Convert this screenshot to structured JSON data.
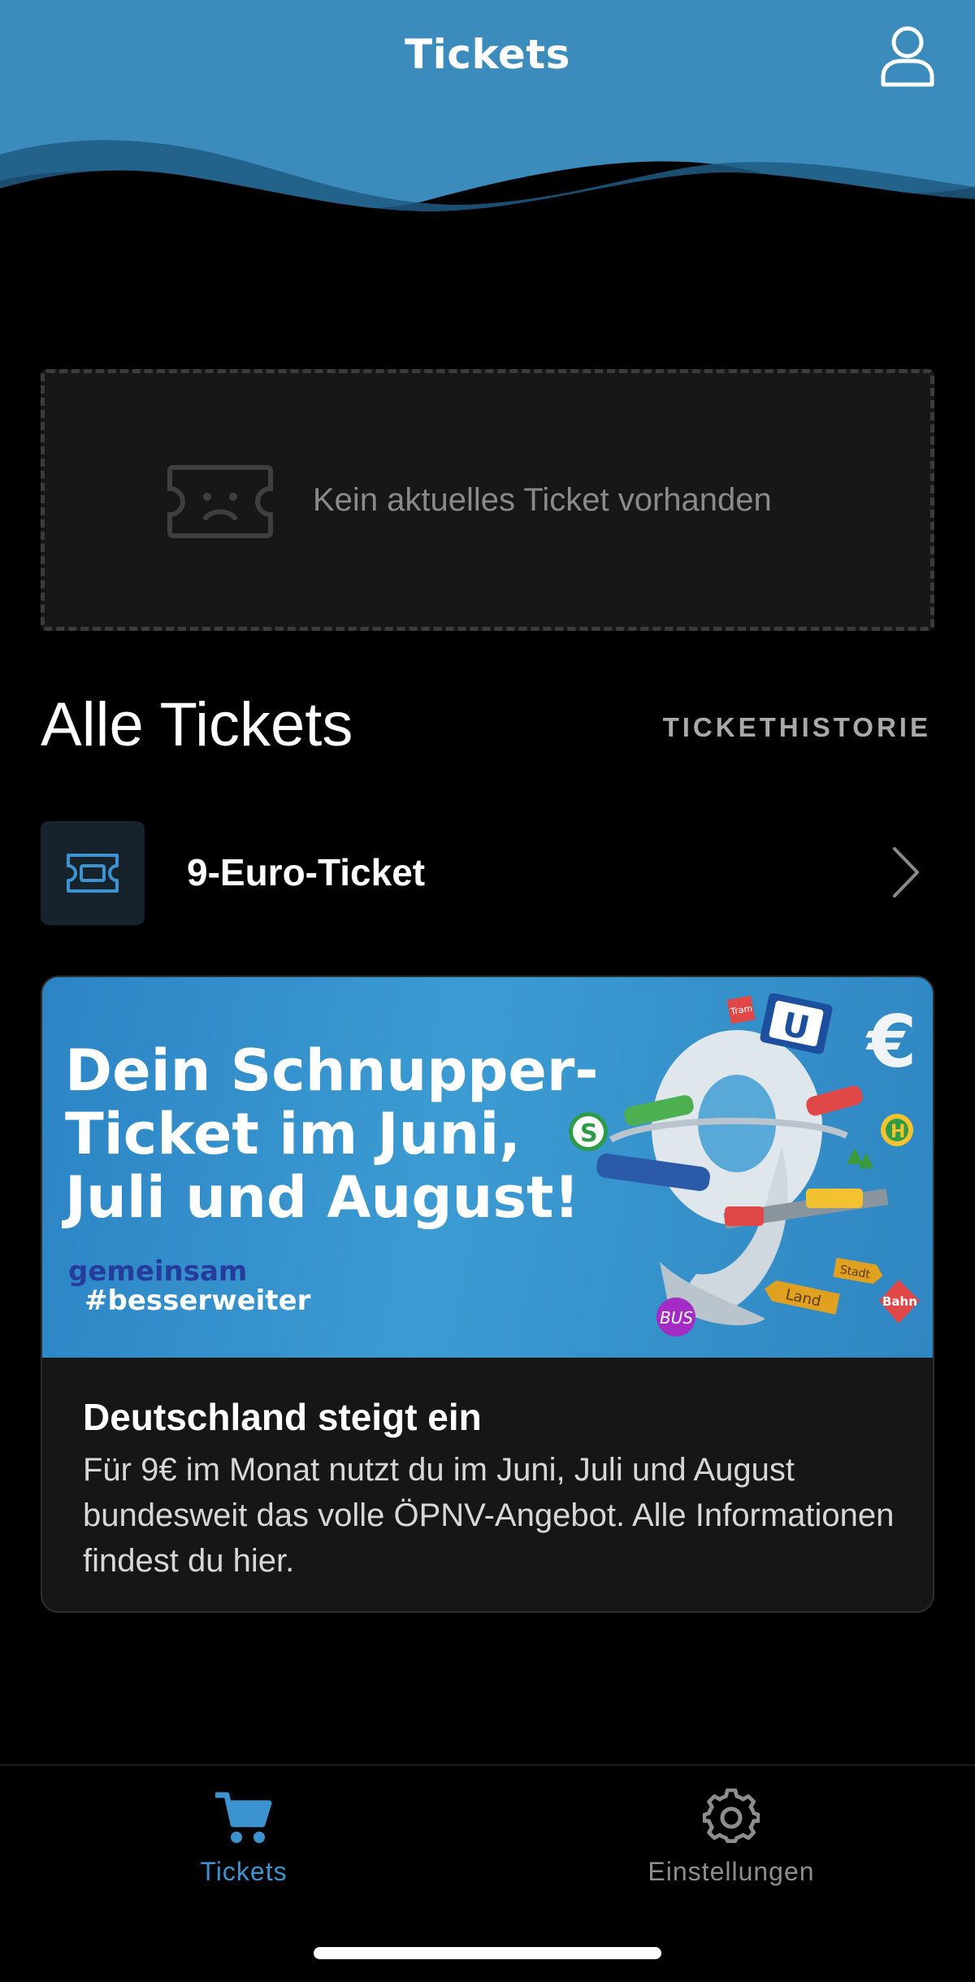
{
  "header": {
    "title": "Tickets",
    "profile_icon": "person-icon",
    "color": "#3b8cbd"
  },
  "empty_state": {
    "icon": "sad-ticket-icon",
    "text": "Kein aktuelles Ticket vorhanden"
  },
  "section": {
    "title": "Alle Tickets",
    "history_link": "TICKETHISTORIE"
  },
  "tickets": [
    {
      "icon": "ticket-icon",
      "name": "9-Euro-Ticket",
      "chevron": "chevron-right-icon"
    }
  ],
  "promo": {
    "banner_headline": "Dein Schnupper-Ticket im Juni, Juli und August!",
    "banner_tag_line1": "gemeinsam",
    "banner_tag_line2": "#besserweiter",
    "title": "Deutschland steigt ein",
    "description": "Für 9€ im Monat nutzt du im Juni, Juli und August bundesweit das volle ÖPNV-Angebot. Alle Informationen findest du hier.",
    "banner_signs": {
      "tram": "Tram",
      "bus": "BUS",
      "stadt": "Stadt",
      "land": "Land",
      "bahn": "Bahn",
      "u": "U",
      "s": "S",
      "euro": "€",
      "h": "H"
    }
  },
  "tabbar": {
    "tabs": [
      {
        "label": "Tickets",
        "icon": "cart-icon",
        "active": true
      },
      {
        "label": "Einstellungen",
        "icon": "gear-icon",
        "active": false
      }
    ],
    "active_color": "#3b94cf",
    "inactive_color": "#8d8d8d"
  }
}
